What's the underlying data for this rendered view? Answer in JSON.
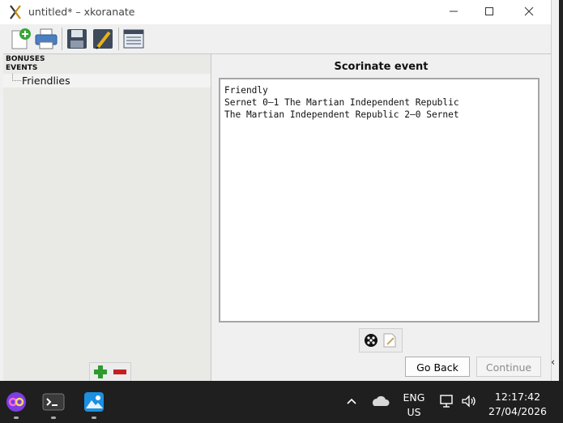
{
  "window": {
    "title": "untitled* – xkoranate",
    "controls": [
      "minimize",
      "maximize",
      "close"
    ]
  },
  "toolbar": {
    "icons": [
      "new-file-icon",
      "print-icon",
      "save-icon",
      "edit-icon",
      "list-icon"
    ]
  },
  "tree": {
    "bonuses_label": "BONUSES",
    "events_label": "EVENTS",
    "items": [
      {
        "label": "Friendlies"
      }
    ]
  },
  "panel": {
    "heading": "Scorinate event",
    "output_lines": [
      "Friendly",
      "Sernet 0–1 The Martian Independent Republic",
      "The Martian Independent Republic 2–0 Sernet"
    ],
    "go_back_label": "Go Back",
    "continue_label": "Continue"
  },
  "tray": {
    "language": "ENG",
    "region": "US",
    "time": "12:17:42",
    "date": "27/04/2026"
  },
  "colors": {
    "add": "#2e9b2e",
    "remove": "#c42020",
    "window_bg": "#f0f0f0",
    "taskbar": "#1f1f1f"
  }
}
